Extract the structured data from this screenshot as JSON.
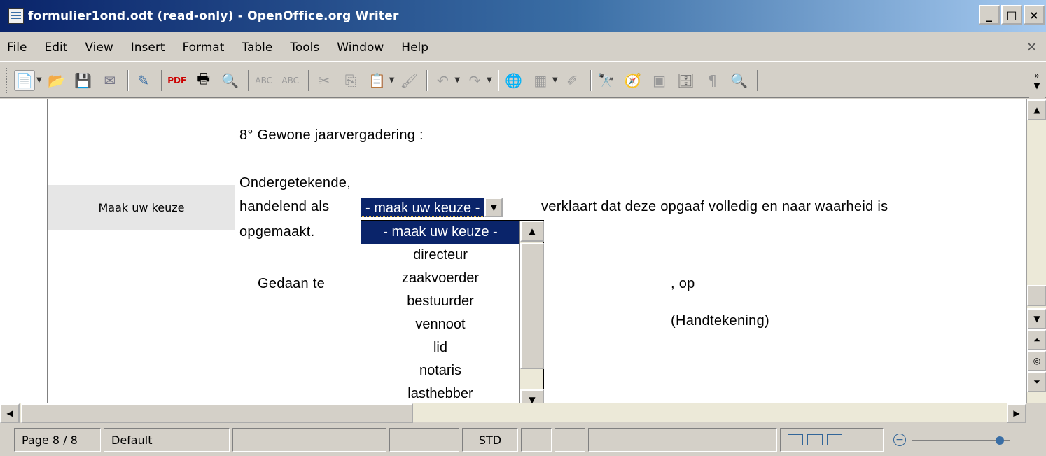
{
  "window": {
    "title": "formulier1ond.odt (read-only) - OpenOffice.org Writer",
    "minimize": "_",
    "maximize": "□",
    "close": "×"
  },
  "menu": {
    "items": [
      "File",
      "Edit",
      "View",
      "Insert",
      "Format",
      "Table",
      "Tools",
      "Window",
      "Help"
    ],
    "close_doc": "×"
  },
  "toolbar": {
    "icons": [
      "new-document",
      "open",
      "save",
      "email",
      "edit-file",
      "export-pdf",
      "print",
      "page-preview",
      "spellcheck",
      "autospellcheck",
      "cut",
      "copy",
      "paste",
      "format-paintbrush",
      "undo",
      "redo",
      "hyperlink",
      "table",
      "show-draw-functions",
      "find-replace",
      "navigator",
      "gallery",
      "data-sources",
      "nonprinting-characters",
      "zoom"
    ],
    "overflow": "»"
  },
  "document": {
    "section_heading": "8° Gewone jaarvergadering :",
    "signer_label": "Ondergetekende,",
    "acting_as": "handelend als",
    "combo_value": "- maak uw keuze -",
    "declares": "verklaart dat deze opgaaf volledig en naar waarheid is",
    "completed": "opgemaakt.",
    "done_at": "Gedaan te",
    "on": ", op",
    "signature": "(Handtekening)"
  },
  "margin_note": {
    "label": "Maak uw keuze"
  },
  "dropdown": {
    "options": [
      "- maak uw keuze -",
      "directeur",
      "zaakvoerder",
      "bestuurder",
      "vennoot",
      "lid",
      "notaris",
      "lasthebber"
    ],
    "selected": "- maak uw keuze -"
  },
  "statusbar": {
    "page": "Page 8 / 8",
    "style": "Default",
    "mode": "STD"
  }
}
